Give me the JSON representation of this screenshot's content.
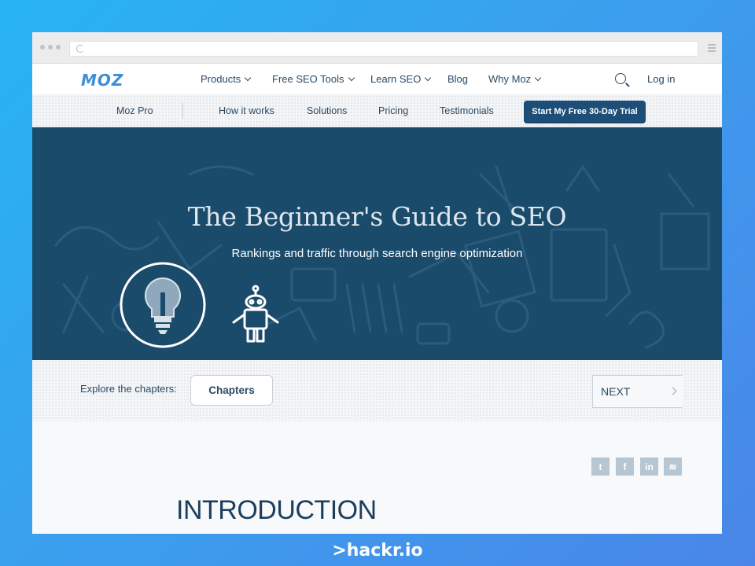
{
  "browser": {
    "menu_icon": "hamburger-icon",
    "reload_icon": "reload-icon"
  },
  "topnav": {
    "logo": "MOZ",
    "items": [
      {
        "label": "Products"
      },
      {
        "label": "Free SEO Tools"
      },
      {
        "label": "Learn SEO"
      },
      {
        "label": "Blog"
      },
      {
        "label": "Why Moz"
      }
    ],
    "search_icon": "search-icon",
    "login": "Log in"
  },
  "subnav": {
    "brand": "Moz Pro",
    "items": [
      "How it works",
      "Solutions",
      "Pricing",
      "Testimonials"
    ],
    "cta": "Start My Free 30-Day Trial"
  },
  "hero": {
    "title": "The Beginner's Guide to SEO",
    "subtitle": "Rankings and traffic through search engine optimization"
  },
  "chapters": {
    "explore_label": "Explore the chapters:",
    "button": "Chapters",
    "next": "NEXT"
  },
  "social": [
    {
      "icon": "twitter-icon",
      "glyph": "t"
    },
    {
      "icon": "facebook-icon",
      "glyph": "f"
    },
    {
      "icon": "linkedin-icon",
      "glyph": "in"
    },
    {
      "icon": "buffer-icon",
      "glyph": "≋"
    }
  ],
  "content": {
    "heading": "INTRODUCTION"
  },
  "footer_brand": ">hackr.io",
  "colors": {
    "brand_blue": "#3b8fd8",
    "navy": "#1b4b6b",
    "cta": "#1c4e78",
    "text": "#2c4a63"
  }
}
